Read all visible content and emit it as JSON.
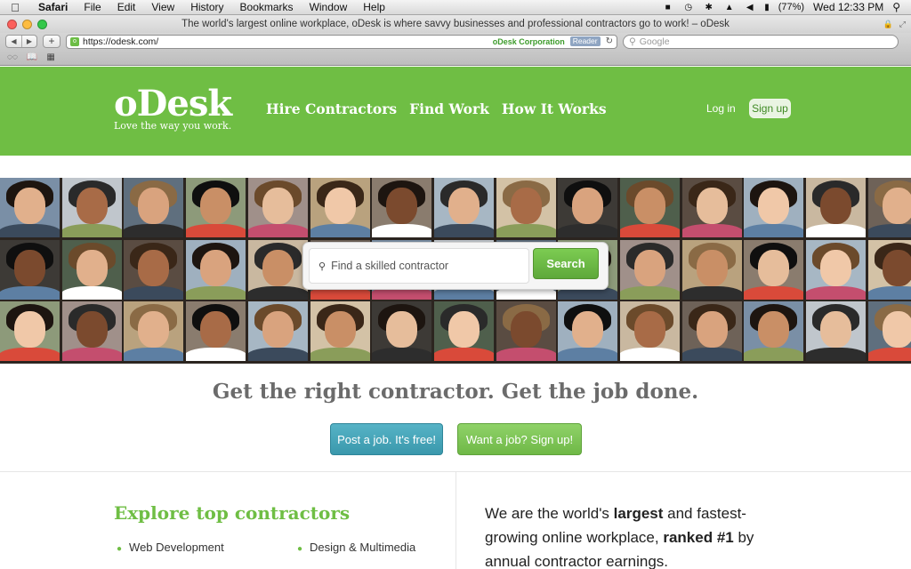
{
  "menubar": {
    "app": "Safari",
    "items": [
      "File",
      "Edit",
      "View",
      "History",
      "Bookmarks",
      "Window",
      "Help"
    ],
    "battery": "(77%)",
    "clock": "Wed 12:33 PM"
  },
  "window": {
    "title": "The world's largest online workplace, oDesk is where savvy businesses and professional contractors go to work! – oDesk"
  },
  "toolbar": {
    "url": "https://odesk.com/",
    "cert": "oDesk Corporation",
    "reader": "Reader",
    "search_placeholder": "Google"
  },
  "header": {
    "logo": "oDesk",
    "logo_tagline": "Love the way you work.",
    "nav": [
      "Hire Contractors",
      "Find Work",
      "How It Works"
    ],
    "login": "Log in",
    "signup": "Sign up"
  },
  "hero": {
    "search_placeholder": "Find a skilled contractor",
    "search_button": "Search"
  },
  "tagline": "Get the right contractor. Get the job done.",
  "cta": {
    "post_job": "Post a job. It's free!",
    "want_job": "Want a job? Sign up!"
  },
  "explore": {
    "title": "Explore top contractors",
    "categories": [
      "Web Development",
      "Design & Multimedia"
    ]
  },
  "about": {
    "t1": "We are the world's ",
    "b1": "largest",
    "t2": " and fastest-growing online workplace, ",
    "b2": "ranked #1",
    "t3": " by annual contractor earnings."
  },
  "colors": {
    "brand_green": "#6fbe44",
    "teal_button": "#3a98ac"
  }
}
